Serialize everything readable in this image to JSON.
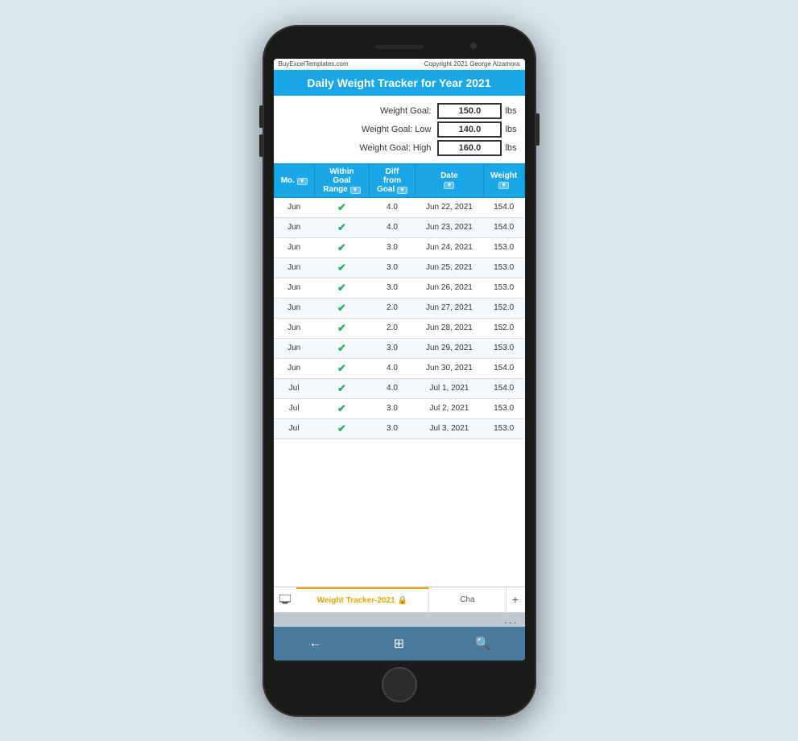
{
  "app": {
    "website": "BuyExcelTemplates.com",
    "copyright": "Copyright 2021  George Alzamora",
    "title": "Daily Weight Tracker for Year 2021"
  },
  "goals": {
    "weight_goal_label": "Weight Goal:",
    "weight_goal_value": "150.0",
    "weight_goal_low_label": "Weight Goal: Low",
    "weight_goal_low_value": "140.0",
    "weight_goal_high_label": "Weight Goal: High",
    "weight_goal_high_value": "160.0",
    "unit": "lbs"
  },
  "table": {
    "headers": {
      "mo": "Mo.",
      "within_goal": "Within Goal Range",
      "diff_from_goal": "Diff from Goal",
      "date": "Date",
      "weight": "Weight"
    },
    "rows": [
      {
        "mo": "Jun",
        "within_goal": true,
        "diff": "4.0",
        "date": "Jun 22, 2021",
        "weight": "154.0"
      },
      {
        "mo": "Jun",
        "within_goal": true,
        "diff": "4.0",
        "date": "Jun 23, 2021",
        "weight": "154.0"
      },
      {
        "mo": "Jun",
        "within_goal": true,
        "diff": "3.0",
        "date": "Jun 24, 2021",
        "weight": "153.0"
      },
      {
        "mo": "Jun",
        "within_goal": true,
        "diff": "3.0",
        "date": "Jun 25, 2021",
        "weight": "153.0"
      },
      {
        "mo": "Jun",
        "within_goal": true,
        "diff": "3.0",
        "date": "Jun 26, 2021",
        "weight": "153.0"
      },
      {
        "mo": "Jun",
        "within_goal": true,
        "diff": "2.0",
        "date": "Jun 27, 2021",
        "weight": "152.0"
      },
      {
        "mo": "Jun",
        "within_goal": true,
        "diff": "2.0",
        "date": "Jun 28, 2021",
        "weight": "152.0"
      },
      {
        "mo": "Jun",
        "within_goal": true,
        "diff": "3.0",
        "date": "Jun 29, 2021",
        "weight": "153.0"
      },
      {
        "mo": "Jun",
        "within_goal": true,
        "diff": "4.0",
        "date": "Jun 30, 2021",
        "weight": "154.0"
      },
      {
        "mo": "Jul",
        "within_goal": true,
        "diff": "4.0",
        "date": "Jul 1, 2021",
        "weight": "154.0"
      },
      {
        "mo": "Jul",
        "within_goal": true,
        "diff": "3.0",
        "date": "Jul 2, 2021",
        "weight": "153.0"
      },
      {
        "mo": "Jul",
        "within_goal": true,
        "diff": "3.0",
        "date": "Jul 3, 2021",
        "weight": "153.0"
      }
    ]
  },
  "tabs": {
    "active": "Weight Tracker-2021",
    "inactive": "Cha",
    "lock_icon": "🔒",
    "add_icon": "+"
  },
  "nav": {
    "back_icon": "←",
    "home_icon": "⊞",
    "search_icon": "🔍"
  },
  "more_dots": "..."
}
